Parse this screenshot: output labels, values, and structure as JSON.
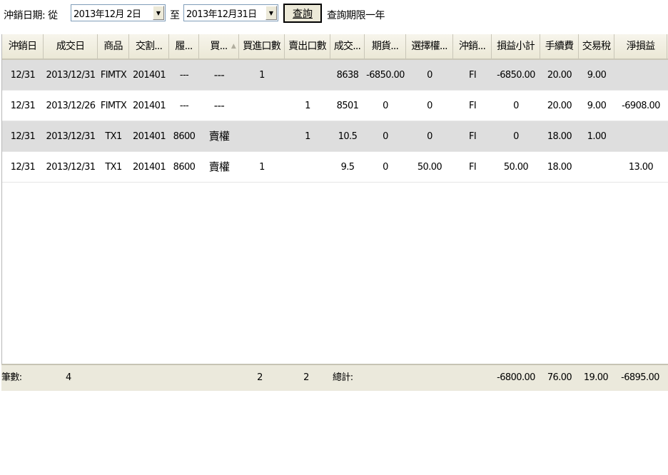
{
  "toolbar": {
    "date_label": "沖銷日期: 從",
    "from_date": "2013年12月 2日",
    "to_label": "至",
    "to_date": "2013年12月31日",
    "query_button": "查詢",
    "limit_note": "查詢期限一年"
  },
  "table": {
    "headers": [
      "沖銷日",
      "成交日",
      "商品",
      "交割...",
      "履...",
      "買...",
      "買進口數",
      "賣出口數",
      "成交...",
      "期貨...",
      "選擇權...",
      "沖銷...",
      "損益小計",
      "手續費",
      "交易稅",
      "淨損益"
    ],
    "sort_indicator": "▲",
    "rows": [
      [
        "12/31",
        "2013/12/31",
        "FIMTX",
        "201401",
        "---",
        "---",
        "1",
        "",
        "8638",
        "-6850.00",
        "0",
        "FI",
        "-6850.00",
        "20.00",
        "9.00",
        ""
      ],
      [
        "12/31",
        "2013/12/26",
        "FIMTX",
        "201401",
        "---",
        "---",
        "",
        "1",
        "8501",
        "0",
        "0",
        "FI",
        "0",
        "20.00",
        "9.00",
        "-6908.00"
      ],
      [
        "12/31",
        "2013/12/31",
        "TX1",
        "201401",
        "8600",
        "賣權",
        "",
        "1",
        "10.5",
        "0",
        "0",
        "FI",
        "0",
        "18.00",
        "1.00",
        ""
      ],
      [
        "12/31",
        "2013/12/31",
        "TX1",
        "201401",
        "8600",
        "賣權",
        "1",
        "",
        "9.5",
        "0",
        "50.00",
        "FI",
        "50.00",
        "18.00",
        "",
        "13.00"
      ]
    ]
  },
  "footer": {
    "count_label": "筆數:",
    "count": "4",
    "buy_total": "2",
    "sell_total": "2",
    "total_label": "總計:",
    "pnl_subtotal": "-6800.00",
    "fee": "76.00",
    "tax": "19.00",
    "net_pnl": "-6895.00"
  },
  "colors": {
    "header_bg": "#ebe8d6",
    "alt_row_bg": "#dedede",
    "footer_bg": "#ebe9dc",
    "button_bg": "#ece9d8"
  }
}
